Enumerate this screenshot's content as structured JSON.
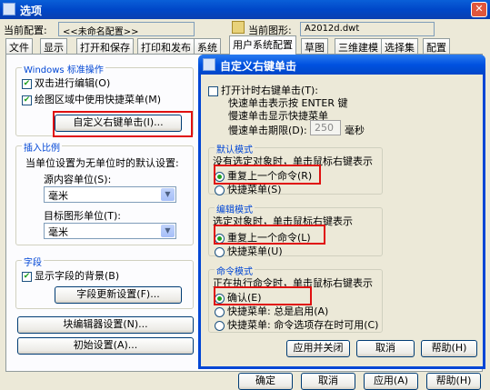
{
  "window": {
    "title": "选项"
  },
  "config": {
    "current_config_label": "当前配置:",
    "current_config_value": "<<未命名配置>>",
    "current_drawing_label": "当前图形:",
    "current_drawing_value": "A2012d.dwt"
  },
  "tabs": [
    "文件",
    "显示",
    "打开和保存",
    "打印和发布",
    "系统",
    "用户系统配置",
    "草图",
    "三维建模",
    "选择集",
    "配置"
  ],
  "windows_group": {
    "label": "Windows 标准操作",
    "dblclick": "双击进行编辑(O)",
    "shortcut": "绘图区域中使用快捷菜单(M)",
    "custom_button": "自定义右键单击(I)..."
  },
  "insert_group": {
    "label": "插入比例",
    "desc": "当单位设置为无单位时的默认设置:",
    "source_label": "源内容单位(S):",
    "source_value": "毫米",
    "target_label": "目标图形单位(T):",
    "target_value": "毫米"
  },
  "field_group": {
    "label": "字段",
    "show_bg": "显示字段的背景(B)",
    "update_button": "字段更新设置(F)..."
  },
  "block_editor_button": "块编辑器设置(N)...",
  "initial_button": "初始设置(A)...",
  "bottom_buttons": [
    "确定",
    "取消",
    "应用(A)",
    "帮助(H)"
  ],
  "popup": {
    "title": "自定义右键单击",
    "timed": "打开计时右键单击(T):",
    "timed_line1": "快速单击表示按 ENTER 键",
    "timed_line2": "慢速单击显示快捷菜单",
    "period_label": "慢速单击期限(D):",
    "period_value": "250",
    "period_unit": "毫秒",
    "default_mode": {
      "label": "默认模式",
      "desc": "没有选定对象时，单击鼠标右键表示",
      "opt1": "重复上一个命令(R)",
      "opt2": "快捷菜单(S)"
    },
    "edit_mode": {
      "label": "编辑模式",
      "desc": "选定对象时，单击鼠标右键表示",
      "opt1": "重复上一个命令(L)",
      "opt2": "快捷菜单(U)"
    },
    "command_mode": {
      "label": "命令模式",
      "desc": "正在执行命令时，单击鼠标右键表示",
      "opt1": "确认(E)",
      "opt2": "快捷菜单: 总是启用(A)",
      "opt3": "快捷菜单: 命令选项存在时可用(C)"
    },
    "buttons": {
      "apply_close": "应用并关闭",
      "cancel": "取消",
      "help": "帮助(H)"
    }
  }
}
